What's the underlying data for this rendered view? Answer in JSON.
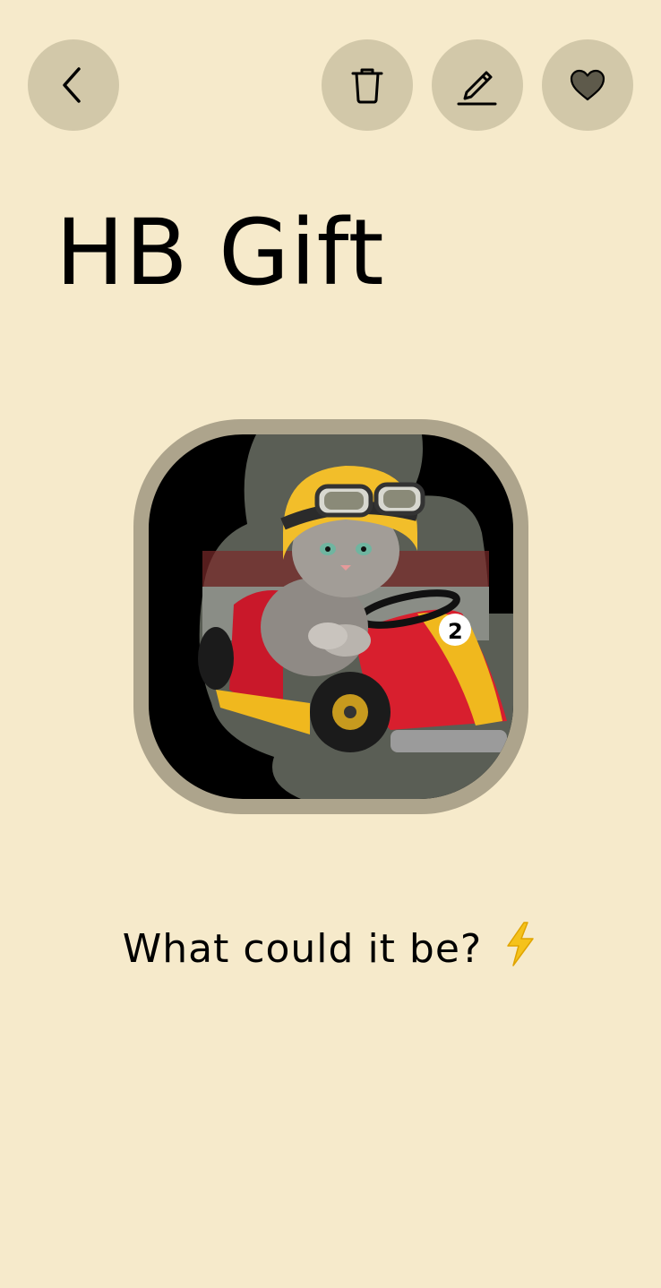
{
  "header": {
    "icons": {
      "back": "chevron-left-icon",
      "delete": "trash-icon",
      "edit": "pencil-icon",
      "favorite": "heart-icon"
    }
  },
  "title": "HB Gift",
  "image": {
    "description_icon": "cat-go-kart-image"
  },
  "caption": {
    "text": "What could it be?",
    "emoji_icon": "lightning-bolt-icon"
  },
  "colors": {
    "background": "#F6EACB",
    "button": "#D2C8A9",
    "frame": "#ADA48C",
    "icon": "#000000",
    "heart_fill": "#5E5A4B",
    "accent_yellow": "#F5C21B"
  }
}
